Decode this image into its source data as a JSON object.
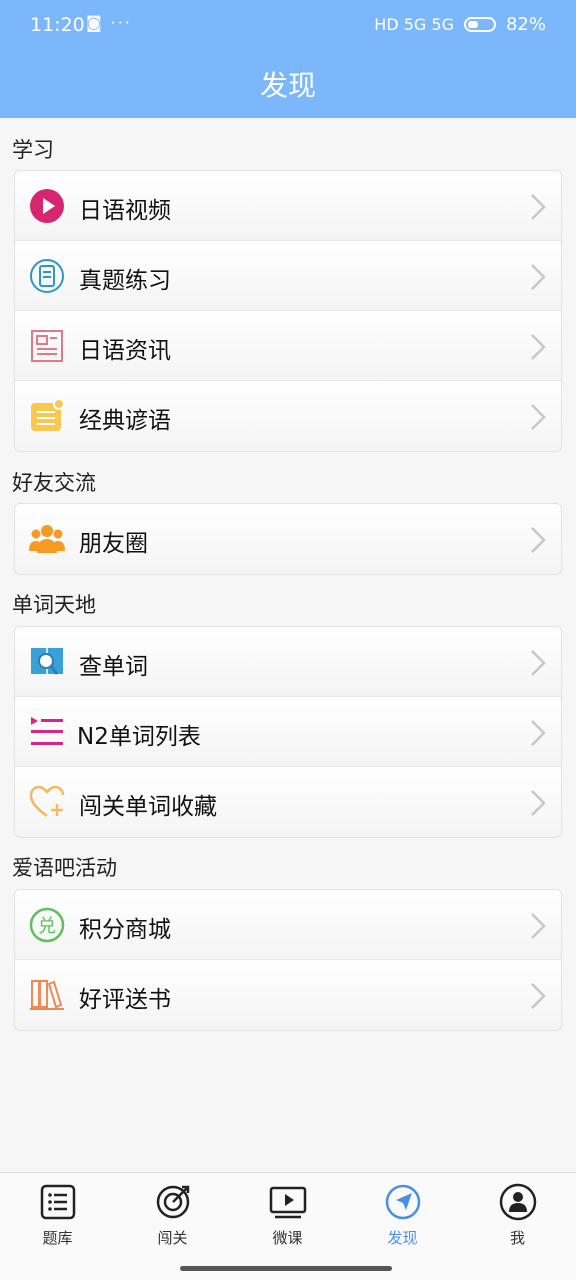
{
  "status_bar": {
    "time": "11:20",
    "misc": "◙ ···",
    "signal": "HD 5G 5G",
    "battery": "82%"
  },
  "header": {
    "title": "发现"
  },
  "sections": [
    {
      "title": "学习",
      "items": [
        {
          "label": "日语视频",
          "icon": "play-video-icon",
          "color": "#d6266f"
        },
        {
          "label": "真题练习",
          "icon": "exam-clipboard-icon",
          "color": "#2a97c9"
        },
        {
          "label": "日语资讯",
          "icon": "newspaper-icon",
          "color": "#e07a8a"
        },
        {
          "label": "经典谚语",
          "icon": "proverb-list-icon",
          "color": "#f9c94f"
        }
      ]
    },
    {
      "title": "好友交流",
      "items": [
        {
          "label": "朋友圈",
          "icon": "friends-group-icon",
          "color": "#f59a23"
        }
      ]
    },
    {
      "title": "单词天地",
      "items": [
        {
          "label": "查单词",
          "icon": "word-search-book-icon",
          "color": "#3aa0d8"
        },
        {
          "label": "N2单词列表",
          "icon": "word-list-icon",
          "color": "#d6268d"
        },
        {
          "label": "闯关单词收藏",
          "icon": "heart-plus-icon",
          "color": "#f4b860"
        }
      ]
    },
    {
      "title": "爱语吧活动",
      "items": [
        {
          "label": "积分商城",
          "icon": "exchange-badge-icon",
          "color": "#5cc05c"
        },
        {
          "label": "好评送书",
          "icon": "bookshelf-icon",
          "color": "#ee8b55"
        }
      ]
    }
  ],
  "tabs": [
    {
      "label": "题库",
      "icon": "list-icon"
    },
    {
      "label": "闯关",
      "icon": "target-icon"
    },
    {
      "label": "微课",
      "icon": "video-screen-icon"
    },
    {
      "label": "发现",
      "icon": "compass-icon",
      "active": true
    },
    {
      "label": "我",
      "icon": "user-icon"
    }
  ],
  "colors": {
    "header": "#7cb6fb",
    "active_tab": "#4a8fe7"
  }
}
